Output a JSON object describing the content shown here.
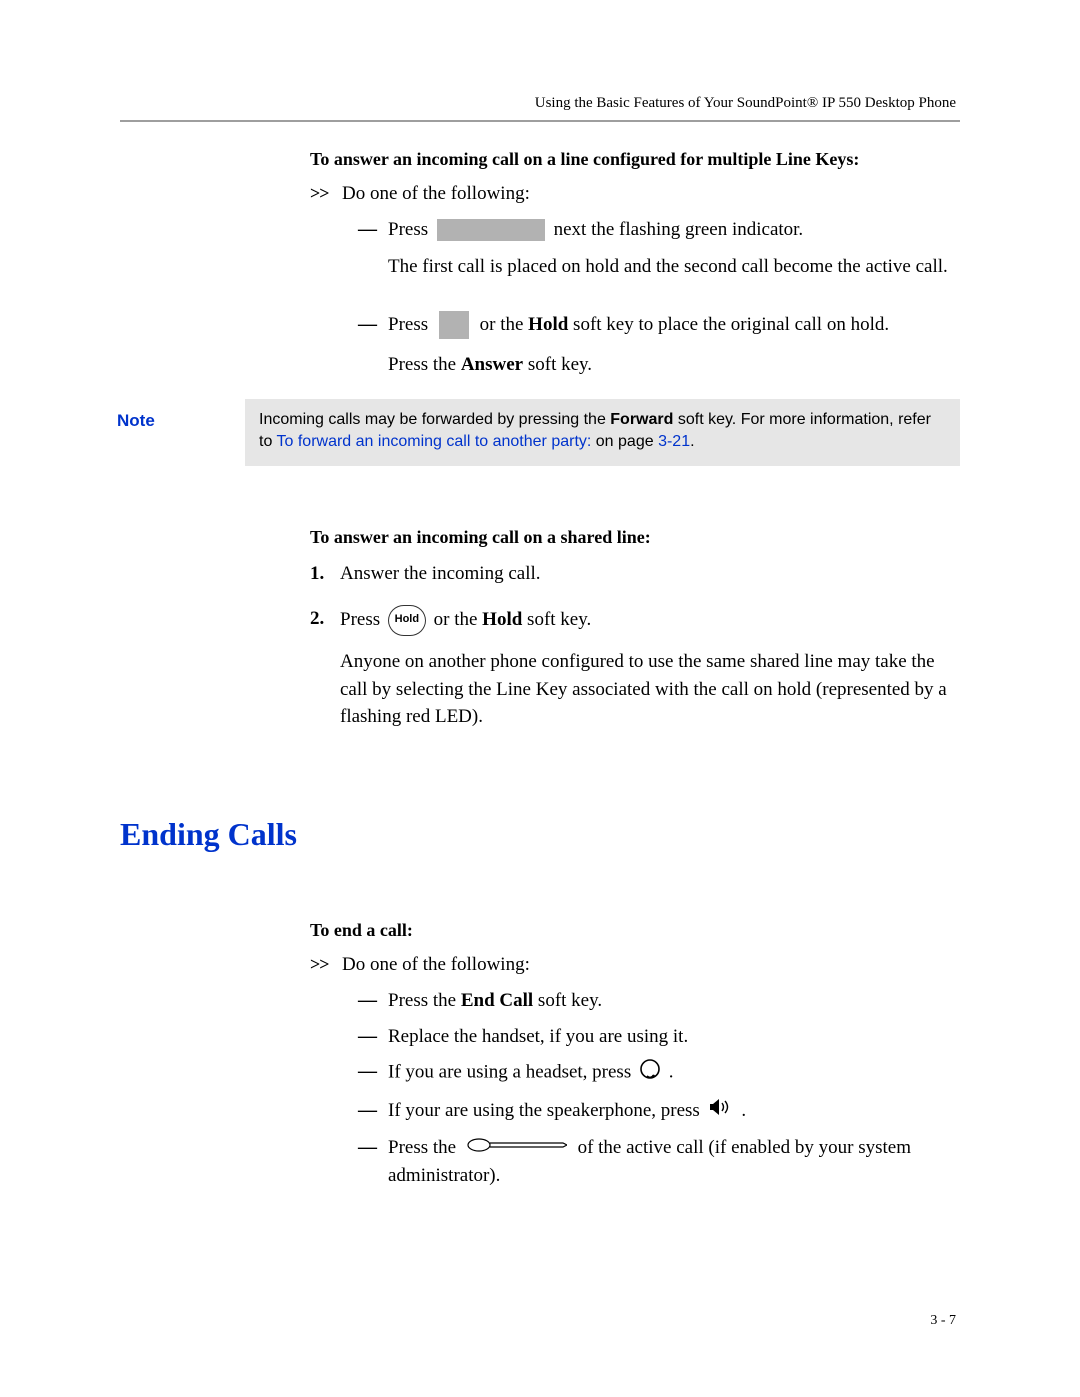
{
  "header": {
    "running": "Using the Basic Features of Your SoundPoint® IP 550 Desktop Phone"
  },
  "sec1": {
    "title": "To answer an incoming call on a line configured for multiple Line Keys:",
    "lead": "Do one of the following:",
    "i1_a": "Press",
    "i1_b": "next the flashing green indicator.",
    "i1_c": "The first call is placed on hold and the second call become the active call.",
    "i2_a": "Press",
    "i2_b": "or the ",
    "i2_bold": "Hold",
    "i2_c": " soft key to place the original call on hold.",
    "i2_d": "Press the ",
    "i2_d_bold": "Answer",
    "i2_e": " soft key."
  },
  "note": {
    "label": "Note",
    "t1": "Incoming calls may be forwarded by pressing the ",
    "t1b": "Forward",
    "t2": " soft key. For more information, refer to ",
    "link": "To forward an incoming call to another party:",
    "t3": " on page ",
    "pref": "3-21",
    "t4": "."
  },
  "sec2": {
    "title": "To answer an incoming call on a shared line:",
    "n1": "1.",
    "n1t": "Answer the incoming call.",
    "n2": "2.",
    "n2a": "Press ",
    "hold": "Hold",
    "n2b": " or the ",
    "n2bold": "Hold",
    "n2c": " soft key.",
    "n2d": "Anyone on another phone configured to use the same shared line may take the call by selecting the Line Key associated with the call on hold (represented by a flashing red LED)."
  },
  "ending": {
    "title": "Ending Calls",
    "sub": "To end a call:",
    "lead": "Do one of the following:",
    "d1a": "Press the ",
    "d1b": "End Call",
    "d1c": " soft key.",
    "d2": "Replace the handset, if you are using it.",
    "d3a": "If you are using a headset, press ",
    "d3b": " .",
    "d4a": "If your are using the speakerphone, press ",
    "d4b": " .",
    "d5a": "Press the ",
    "d5b": " of the active call (if enabled by your system administrator)."
  },
  "pagenum": "3 - 7"
}
